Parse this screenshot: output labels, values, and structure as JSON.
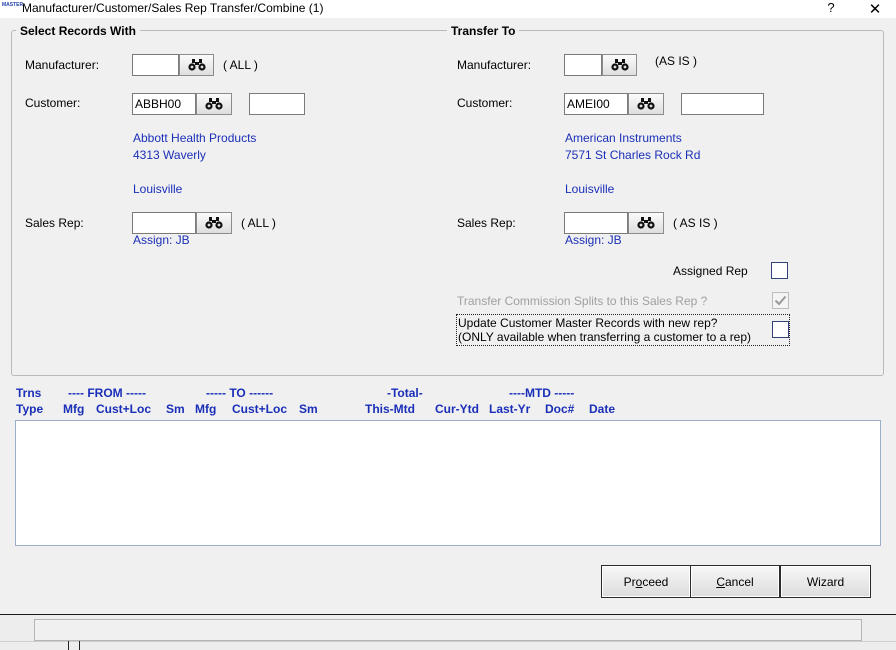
{
  "window": {
    "title": "Manufacturer/Customer/Sales Rep Transfer/Combine (1)",
    "help_glyph": "?",
    "close_glyph": "✕",
    "app_icon_text": "MASTER"
  },
  "select": {
    "legend": "Select Records With",
    "manufacturer_label": "Manufacturer:",
    "manufacturer_value": "",
    "manufacturer_hint": "( ALL )",
    "customer_label": "Customer:",
    "customer_value": "ABBH00",
    "customer_extra": "",
    "customer_name": "Abbott Health Products",
    "customer_address": "4313 Waverly",
    "customer_city": "Louisville",
    "salesrep_label": "Sales Rep:",
    "salesrep_value": "",
    "salesrep_hint": "( ALL )",
    "assign": "Assign: JB"
  },
  "transfer": {
    "legend": "Transfer To",
    "manufacturer_label": "Manufacturer:",
    "manufacturer_value": "",
    "manufacturer_hint": "(AS IS )",
    "customer_label": "Customer:",
    "customer_value": "AMEI00",
    "customer_extra": "",
    "customer_name": "American Instruments",
    "customer_address": "7571 St Charles Rock Rd",
    "customer_city": "Louisville",
    "salesrep_label": "Sales Rep:",
    "salesrep_value": "",
    "salesrep_hint": "( AS IS )",
    "assign": "Assign: JB",
    "assigned_rep_label": "Assigned Rep",
    "assigned_rep_checked": false,
    "commission_label": "Transfer Commission Splits to this Sales Rep ?",
    "commission_checked": true,
    "update_master_line1": "Update Customer Master Records with new rep?",
    "update_master_line2": "(ONLY available when transferring a customer to a rep)",
    "update_master_checked": false
  },
  "grid": {
    "row1": {
      "trns": "Trns",
      "from": "---- FROM -----",
      "to": "----- TO ------",
      "total": "-Total-",
      "mtd": "----MTD -----"
    },
    "row2": {
      "type": "Type",
      "mfg1": "Mfg",
      "custloc1": "Cust+Loc",
      "sm1": "Sm",
      "mfg2": "Mfg",
      "custloc2": "Cust+Loc",
      "sm2": "Sm",
      "this_mtd": "This-Mtd",
      "cur_ytd": "Cur-Ytd",
      "last_yr": "Last-Yr",
      "doc": "Doc#",
      "date": "Date"
    },
    "rows": []
  },
  "buttons": {
    "proceed": {
      "pre": "Pr",
      "key": "o",
      "post": "ceed"
    },
    "cancel": {
      "pre": "",
      "key": "C",
      "post": "ancel"
    },
    "wizard": {
      "pre": "",
      "key": "",
      "post": "Wizard"
    }
  },
  "status": {
    "text": ""
  },
  "colors": {
    "accent_text": "#1a2fb8",
    "checkbox_border": "#33427a",
    "list_border": "#9bb0c8"
  }
}
